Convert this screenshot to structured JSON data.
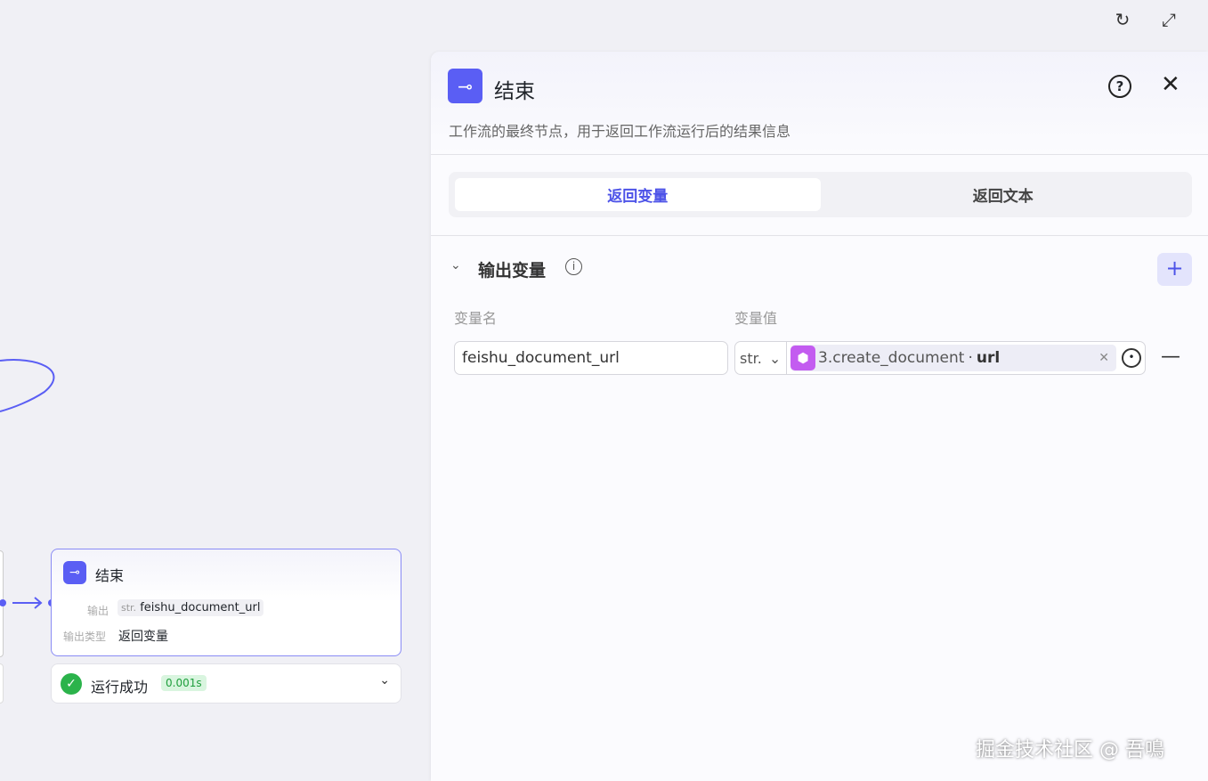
{
  "toolbar": {
    "refresh_icon": "refresh-icon",
    "expand_icon": "expand-icon"
  },
  "panel": {
    "title": "结束",
    "description": "工作流的最终节点，用于返回工作流运行后的结果信息",
    "tabs": [
      {
        "label": "返回变量",
        "active": true
      },
      {
        "label": "返回文本",
        "active": false
      }
    ],
    "section": {
      "title": "输出变量",
      "col_name": "变量名",
      "col_value": "变量值",
      "rows": [
        {
          "name": "feishu_document_url",
          "type": "str.",
          "ref_node": "3.create_document",
          "ref_sep": "·",
          "ref_field": "url"
        }
      ]
    }
  },
  "node": {
    "title": "结束",
    "output_label": "输出",
    "output_type_tag": "str.",
    "output_name": "feishu_document_url",
    "output_type_label": "输出类型",
    "output_type_value": "返回变量"
  },
  "run_status": {
    "label": "运行成功",
    "time": "0.001s"
  },
  "watermark": "掘金技术社区 @ 吾鳴",
  "colors": {
    "accent": "#4d53e8",
    "node_icon": "#5a5ef4",
    "success": "#2bb34b",
    "ref_icon": "#c35cf0"
  }
}
